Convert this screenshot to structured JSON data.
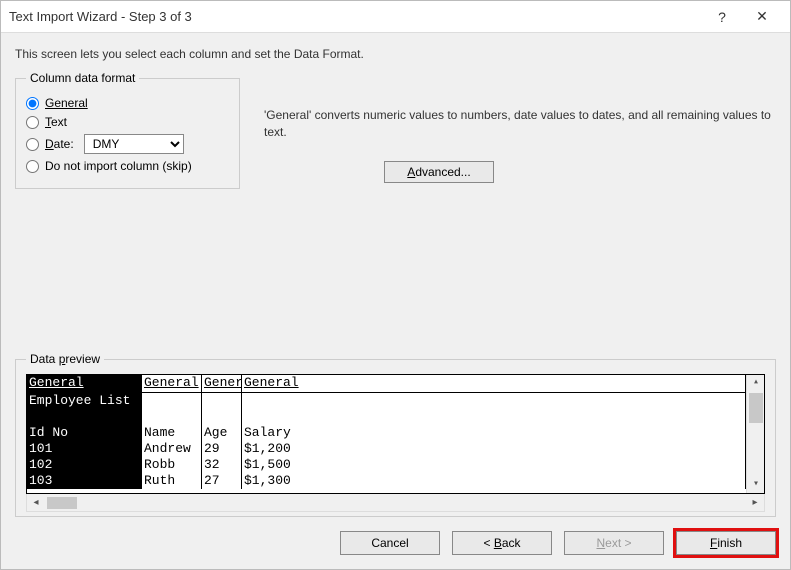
{
  "titlebar": {
    "title": "Text Import Wizard - Step 3 of 3",
    "help": "?",
    "close": "✕"
  },
  "instruction": "This screen lets you select each column and set the Data Format.",
  "column_format": {
    "legend": "Column data format",
    "general": "General",
    "text": "Text",
    "date": "Date:",
    "date_value": "DMY",
    "skip": "Do not import column (skip)"
  },
  "description": "'General' converts numeric values to numbers, date values to dates, and all remaining values to text.",
  "advanced_label": "Advanced...",
  "preview": {
    "legend": "Data preview",
    "heads": [
      "General",
      "General",
      "Gener",
      "General"
    ],
    "rows": [
      [
        "Employee List",
        "",
        "",
        ""
      ],
      [
        "",
        "",
        "",
        ""
      ],
      [
        "Id No",
        "Name",
        "Age",
        "Salary"
      ],
      [
        "101",
        "Andrew",
        "29",
        "$1,200"
      ],
      [
        "102",
        "Robb",
        "32",
        "$1,500"
      ],
      [
        "103",
        "Ruth",
        "27",
        "$1,300"
      ]
    ]
  },
  "footer": {
    "cancel": "Cancel",
    "back": "< Back",
    "next": "Next >",
    "finish": "Finish"
  }
}
